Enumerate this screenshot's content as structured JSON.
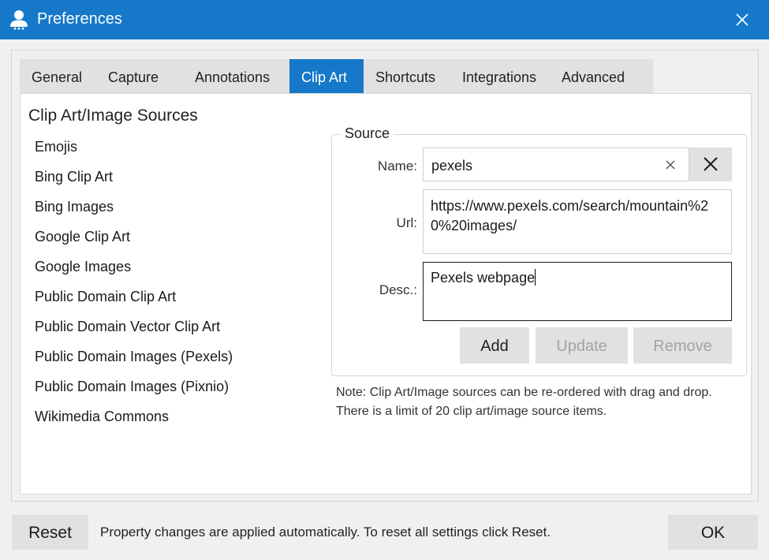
{
  "window": {
    "title": "Preferences",
    "app_icon": "user-icon",
    "close_icon": "close-icon",
    "accent_color": "#1578c8"
  },
  "tabs": [
    {
      "label": "General"
    },
    {
      "label": "Capture"
    },
    {
      "label": "Annotations"
    },
    {
      "label": "Clip Art",
      "active": true
    },
    {
      "label": "Shortcuts"
    },
    {
      "label": "Integrations"
    },
    {
      "label": "Advanced"
    }
  ],
  "clipart": {
    "heading": "Clip Art/Image Sources",
    "sources": [
      "Emojis",
      "Bing Clip Art",
      "Bing Images",
      "Google Clip Art",
      "Google Images",
      "Public Domain Clip Art",
      "Public Domain Vector Clip Art",
      "Public Domain Images (Pexels)",
      "Public Domain Images (Pixnio)",
      "Wikimedia Commons"
    ],
    "group_title": "Source",
    "name_label": "Name:",
    "name_value": "pexels",
    "url_label": "Url:",
    "url_value": "https://www.pexels.com/search/mountain%20%20images/",
    "desc_label": "Desc.:",
    "desc_value": "Pexels webpage",
    "add_label": "Add",
    "update_label": "Update",
    "remove_label": "Remove",
    "note": "Note: Clip Art/Image sources can be re-ordered with drag and drop. There is a limit of 20 clip art/image source items."
  },
  "footer": {
    "reset_label": "Reset",
    "status": "Property changes are applied automatically. To reset all settings click Reset.",
    "ok_label": "OK"
  }
}
